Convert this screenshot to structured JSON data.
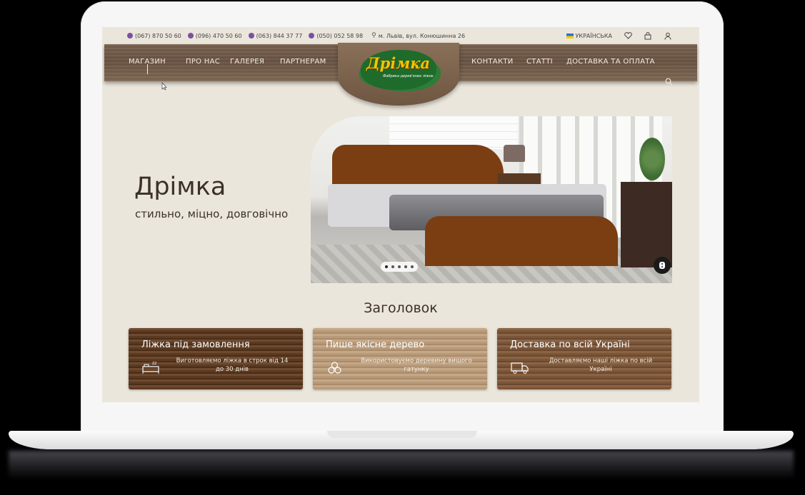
{
  "topbar": {
    "phones": [
      "(067) 870 50 60",
      "(096) 470 50 60",
      "(063) 844 37 77",
      "(050) 052 58 98"
    ],
    "address": "м. Львів, вул. Конюшинна 26",
    "language": "УКРАЇНСЬКА",
    "icons": [
      "heart-icon",
      "cart-icon",
      "user-icon"
    ]
  },
  "nav": {
    "left": [
      "МАГАЗИН",
      "ПРО НАС",
      "ГАЛЕРЕЯ",
      "ПАРТНЕРАМ"
    ],
    "right": [
      "КОНТАКТИ",
      "СТАТТІ",
      "ДОСТАВКА ТА ОПЛАТА"
    ],
    "logo": "Дрімка",
    "logo_sub": "Фабрика дерев'яних ліжок"
  },
  "hero": {
    "title": "Дрімка",
    "subtitle": "стильно, міцно, довговічно",
    "slides": 5,
    "active_slide": 1
  },
  "section": {
    "title": "Заголовок"
  },
  "cards": [
    {
      "title": "Ліжка під замовлення",
      "text": "Виготовляємо ліжка в строк від 14 до 30 днів",
      "icon": "bed-icon"
    },
    {
      "title": "Пише якісне дерево",
      "text": "Використовуємо деревину вищого гатунку",
      "icon": "wood-logs-icon"
    },
    {
      "title": "Доставка по всій Україні",
      "text": "Доставляємо наші ліжка по всій Україні",
      "icon": "delivery-truck-icon"
    }
  ],
  "colors": {
    "background": "#ebe6dc",
    "nav_wood": "#6b5444",
    "viber": "#7b519d",
    "logo_yellow": "#f2c400",
    "logo_green": "#1f6b2c"
  }
}
